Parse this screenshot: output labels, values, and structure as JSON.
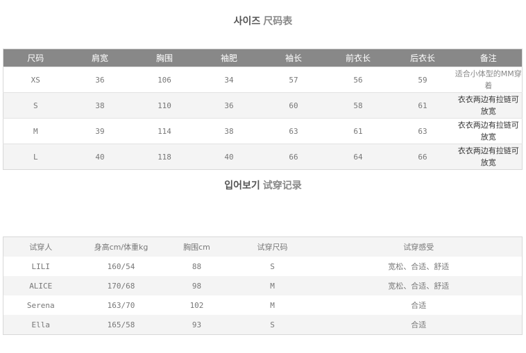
{
  "size_section": {
    "title_ko": "사이즈",
    "title_zh": "尺码表",
    "headers": [
      "尺码",
      "肩宽",
      "胸围",
      "袖肥",
      "袖长",
      "前衣长",
      "后衣长",
      "备注"
    ],
    "rows": [
      {
        "size": "XS",
        "shoulder": "36",
        "chest": "106",
        "sleeve_width": "34",
        "sleeve_length": "57",
        "front_length": "56",
        "back_length": "59",
        "note": "适合小体型的MM穿着"
      },
      {
        "size": "S",
        "shoulder": "38",
        "chest": "110",
        "sleeve_width": "36",
        "sleeve_length": "60",
        "front_length": "58",
        "back_length": "61",
        "note": "衣衣两边有拉链可放宽"
      },
      {
        "size": "M",
        "shoulder": "39",
        "chest": "114",
        "sleeve_width": "38",
        "sleeve_length": "63",
        "front_length": "61",
        "back_length": "63",
        "note": "衣衣两边有拉链可放宽"
      },
      {
        "size": "L",
        "shoulder": "40",
        "chest": "118",
        "sleeve_width": "40",
        "sleeve_length": "66",
        "front_length": "64",
        "back_length": "66",
        "note": "衣衣两边有拉链可放宽"
      }
    ]
  },
  "try_section": {
    "title_ko": "입어보기",
    "title_zh": "试穿记录",
    "headers": [
      "试穿人",
      "身高cm/体重kg",
      "胸围cm",
      "试穿尺码",
      "试穿感受"
    ],
    "rows": [
      {
        "name": "LILI",
        "height_weight": "160/54",
        "chest": "88",
        "size": "S",
        "feeling": "宽松、合适、舒适"
      },
      {
        "name": "ALICE",
        "height_weight": "170/68",
        "chest": "98",
        "size": "M",
        "feeling": "宽松、合适、舒适"
      },
      {
        "name": "Serena",
        "height_weight": "163/70",
        "chest": "102",
        "size": "M",
        "feeling": "合适"
      },
      {
        "name": "Ella",
        "height_weight": "165/58",
        "chest": "93",
        "size": "S",
        "feeling": "合适"
      }
    ]
  }
}
